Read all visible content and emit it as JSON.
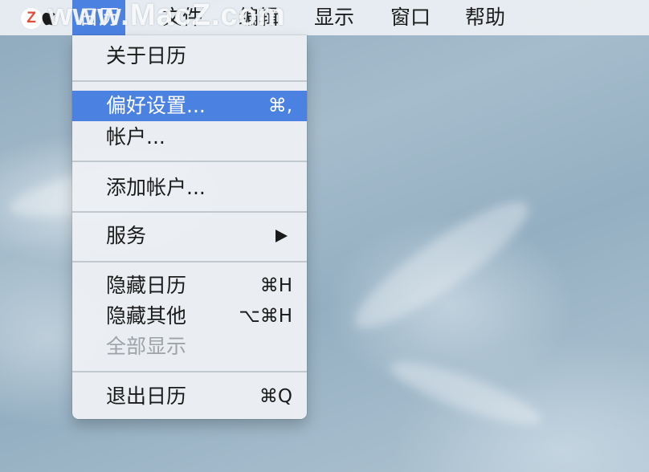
{
  "menubar": {
    "logo_text": "Z",
    "watermark": "www.MacZ.com",
    "menus": [
      "日历",
      "文件",
      "编辑",
      "显示",
      "窗口",
      "帮助"
    ]
  },
  "calendar_menu": {
    "about": "关于日历",
    "preferences": {
      "label": "偏好设置...",
      "shortcut": "⌘,"
    },
    "accounts": "帐户...",
    "add_account": "添加帐户...",
    "services": "服务",
    "hide_calendar": {
      "label": "隐藏日历",
      "shortcut": "⌘H"
    },
    "hide_others": {
      "label": "隐藏其他",
      "shortcut": "⌥⌘H"
    },
    "show_all": "全部显示",
    "quit": {
      "label": "退出日历",
      "shortcut": "⌘Q"
    }
  },
  "colors": {
    "highlight": "#4b82e2",
    "menu_background": "#ecf0f4",
    "disabled_text": "#9ea3a8"
  }
}
